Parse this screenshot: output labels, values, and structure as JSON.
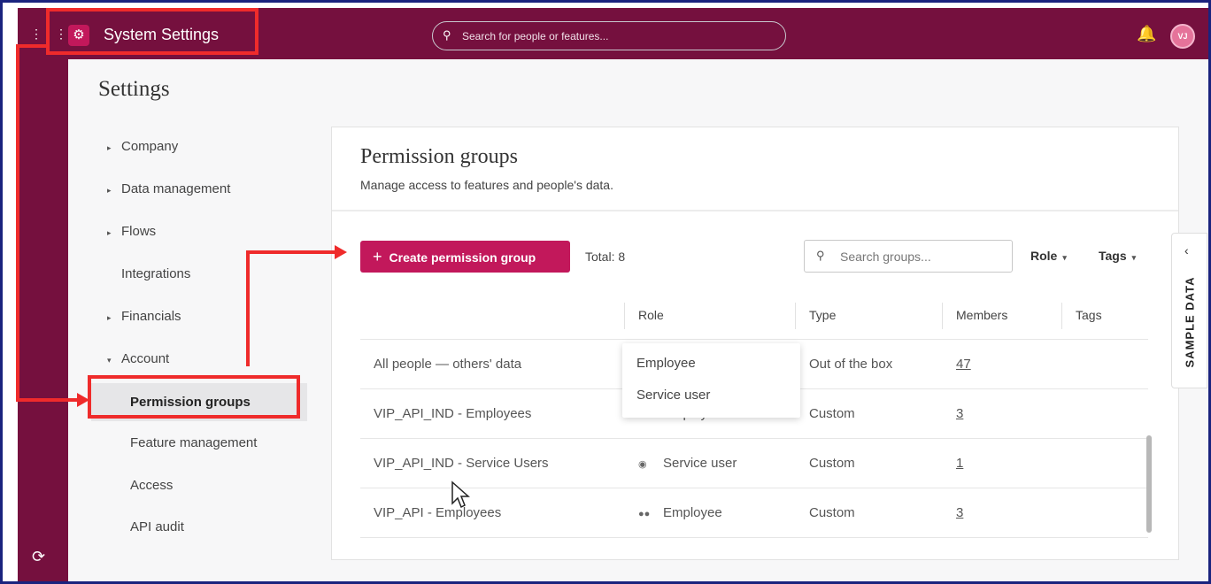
{
  "topbar": {
    "app_title": "System Settings",
    "search_placeholder": "Search for people or features...",
    "avatar_initials": "VJ"
  },
  "sidebar": {
    "title": "Settings",
    "items": [
      {
        "label": "Company",
        "caret": "▸"
      },
      {
        "label": "Data management",
        "caret": "▸"
      },
      {
        "label": "Flows",
        "caret": "▸"
      },
      {
        "label": "Integrations",
        "caret": ""
      },
      {
        "label": "Financials",
        "caret": "▸"
      },
      {
        "label": "Account",
        "caret": "▾"
      }
    ],
    "sub_items": [
      {
        "label": "Permission groups",
        "active": true
      },
      {
        "label": "Feature management"
      },
      {
        "label": "Access"
      },
      {
        "label": "API audit"
      }
    ]
  },
  "card": {
    "title": "Permission groups",
    "subtitle": "Manage access to features and people's data.",
    "create_button": "Create permission group",
    "total": "Total: 8",
    "search_placeholder": "Search groups...",
    "filters": [
      "Role",
      "Tags"
    ],
    "columns": [
      "Role",
      "Type",
      "Members",
      "Tags"
    ],
    "dropdown": [
      "Employee",
      "Service user"
    ],
    "rows": [
      {
        "name": "All people — others' data",
        "role": "Employee",
        "role_icon": "people-icon",
        "type": "Out of the box",
        "members": "47"
      },
      {
        "name": "VIP_API_IND - Employees",
        "role": "Employee",
        "role_icon": "people-icon",
        "type": "Custom",
        "members": "3"
      },
      {
        "name": "VIP_API_IND - Service Users",
        "role": "Service user",
        "role_icon": "service-user-icon",
        "type": "Custom",
        "members": "1"
      },
      {
        "name": "VIP_API - Employees",
        "role": "Employee",
        "role_icon": "people-icon",
        "type": "Custom",
        "members": "3"
      }
    ]
  },
  "sample_tab": {
    "label": "SAMPLE DATA"
  },
  "colors": {
    "brand": "#75103e",
    "accent": "#c2185b",
    "highlight": "#ef2b2b",
    "frame_border": "#1a237e"
  }
}
